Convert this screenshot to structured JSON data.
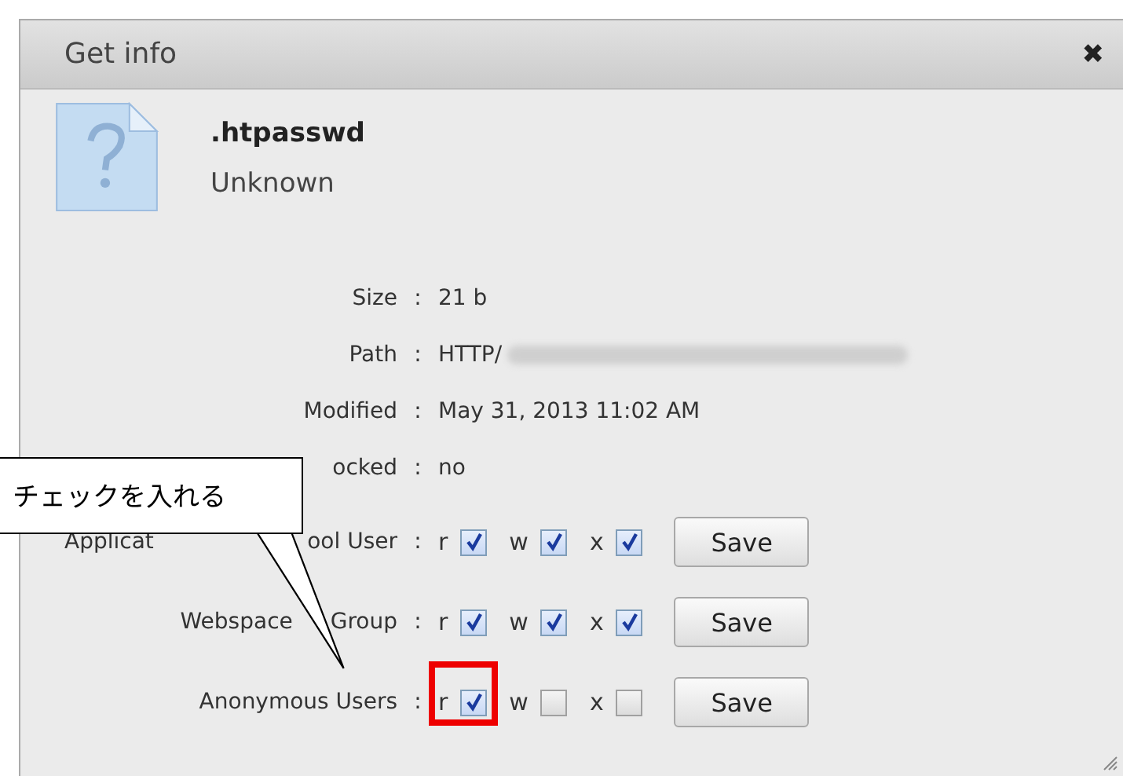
{
  "window": {
    "title": "Get info",
    "close": "✖"
  },
  "file": {
    "name": ".htpasswd",
    "type": "Unknown"
  },
  "info": [
    {
      "label": "Size",
      "sep": ":",
      "value": "21 b"
    },
    {
      "label": "Path",
      "sep": ":",
      "value": "HTTP/",
      "redacted": true
    },
    {
      "label": "Modified",
      "sep": ":",
      "value": "May 31, 2013 11:02 AM"
    },
    {
      "label": "ocked",
      "sep": ":",
      "value": "no"
    }
  ],
  "permissions": [
    {
      "label_parts": [
        "Applicat",
        "ool User"
      ],
      "sep": ":",
      "flags": [
        {
          "letter": "r",
          "checked": true
        },
        {
          "letter": "w",
          "checked": true
        },
        {
          "letter": "x",
          "checked": true
        }
      ],
      "button": "Save"
    },
    {
      "label_parts": [
        "Webspace",
        "Group"
      ],
      "sep": ":",
      "flags": [
        {
          "letter": "r",
          "checked": true
        },
        {
          "letter": "w",
          "checked": true
        },
        {
          "letter": "x",
          "checked": true
        }
      ],
      "button": "Save"
    },
    {
      "label_parts": [
        "Anonymous Users"
      ],
      "sep": ":",
      "flags": [
        {
          "letter": "r",
          "checked": true
        },
        {
          "letter": "w",
          "checked": false
        },
        {
          "letter": "x",
          "checked": false
        }
      ],
      "button": "Save"
    }
  ],
  "callout": {
    "text": "チェックを入れる"
  }
}
